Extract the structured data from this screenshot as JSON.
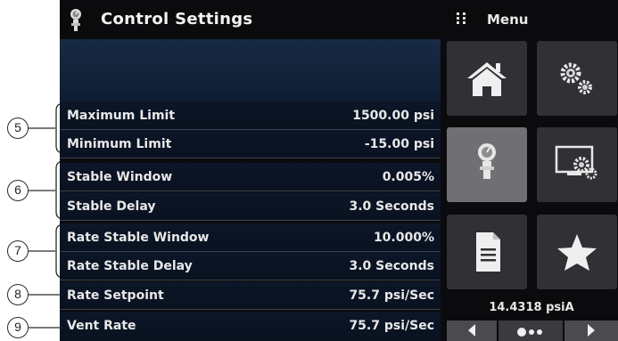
{
  "header": {
    "title": "Control Settings",
    "icon": "gauge-icon"
  },
  "menu": {
    "label": "Menu",
    "icon": "menu-grid-icon",
    "tiles": [
      {
        "icon": "home-icon",
        "selected": false
      },
      {
        "icon": "gears-icon",
        "selected": false
      },
      {
        "icon": "gauge-icon",
        "selected": true
      },
      {
        "icon": "display-settings-icon",
        "selected": false
      },
      {
        "icon": "document-icon",
        "selected": false
      },
      {
        "icon": "star-icon",
        "selected": false
      }
    ]
  },
  "settings": {
    "rows": [
      {
        "label": "Maximum Limit",
        "value": "1500.00 psi"
      },
      {
        "label": "Minimum Limit",
        "value": "-15.00 psi"
      },
      {
        "label": "Stable Window",
        "value": "0.005%"
      },
      {
        "label": "Stable Delay",
        "value": "3.0 Seconds"
      },
      {
        "label": "Rate Stable Window",
        "value": "10.000%"
      },
      {
        "label": "Rate Stable Delay",
        "value": "3.0 Seconds"
      },
      {
        "label": "Rate Setpoint",
        "value": "75.7 psi/Sec"
      },
      {
        "label": "Vent Rate",
        "value": "75.7 psi/Sec"
      }
    ]
  },
  "status": {
    "pressure": "14.4318 psiA"
  },
  "callouts": [
    "5",
    "6",
    "7",
    "8",
    "9"
  ],
  "colors": {
    "background": "#0b0b0d",
    "row_background": "#0c1628",
    "tile": "#303035",
    "tile_selected": "#707074",
    "text": "#e8e8e8"
  }
}
